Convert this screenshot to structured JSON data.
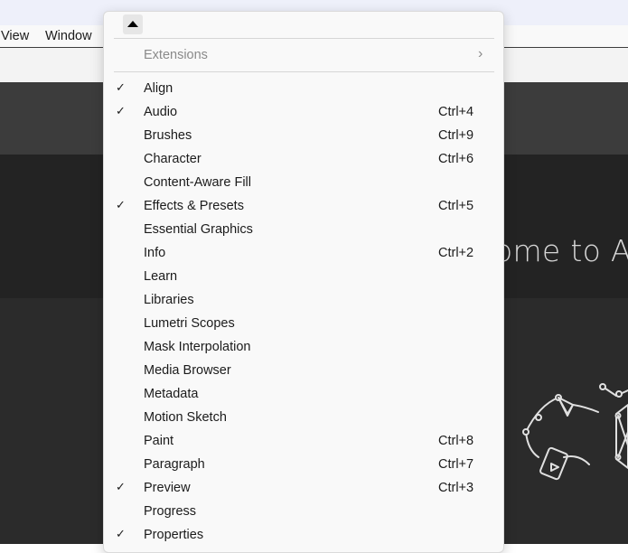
{
  "menubar": {
    "view_label": "View",
    "window_label": "Window"
  },
  "welcome_text": "ome to Af",
  "menu": {
    "extensions": {
      "label": "Extensions"
    },
    "items": [
      {
        "label": "Align",
        "checked": true,
        "shortcut": ""
      },
      {
        "label": "Audio",
        "checked": true,
        "shortcut": "Ctrl+4"
      },
      {
        "label": "Brushes",
        "checked": false,
        "shortcut": "Ctrl+9"
      },
      {
        "label": "Character",
        "checked": false,
        "shortcut": "Ctrl+6"
      },
      {
        "label": "Content-Aware Fill",
        "checked": false,
        "shortcut": ""
      },
      {
        "label": "Effects & Presets",
        "checked": true,
        "shortcut": "Ctrl+5"
      },
      {
        "label": "Essential Graphics",
        "checked": false,
        "shortcut": ""
      },
      {
        "label": "Info",
        "checked": false,
        "shortcut": "Ctrl+2"
      },
      {
        "label": "Learn",
        "checked": false,
        "shortcut": ""
      },
      {
        "label": "Libraries",
        "checked": false,
        "shortcut": ""
      },
      {
        "label": "Lumetri Scopes",
        "checked": false,
        "shortcut": ""
      },
      {
        "label": "Mask Interpolation",
        "checked": false,
        "shortcut": ""
      },
      {
        "label": "Media Browser",
        "checked": false,
        "shortcut": ""
      },
      {
        "label": "Metadata",
        "checked": false,
        "shortcut": ""
      },
      {
        "label": "Motion Sketch",
        "checked": false,
        "shortcut": ""
      },
      {
        "label": "Paint",
        "checked": false,
        "shortcut": "Ctrl+8"
      },
      {
        "label": "Paragraph",
        "checked": false,
        "shortcut": "Ctrl+7"
      },
      {
        "label": "Preview",
        "checked": true,
        "shortcut": "Ctrl+3"
      },
      {
        "label": "Progress",
        "checked": false,
        "shortcut": ""
      },
      {
        "label": "Properties",
        "checked": true,
        "shortcut": ""
      }
    ]
  }
}
